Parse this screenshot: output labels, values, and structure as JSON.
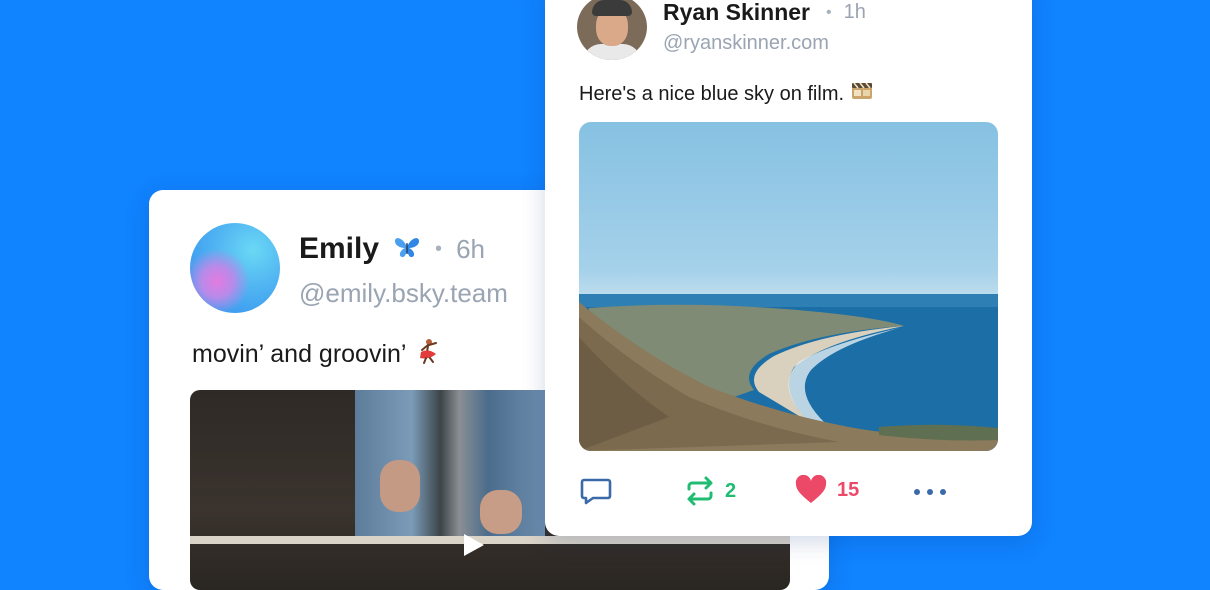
{
  "posts": {
    "emily": {
      "display_name": "Emily",
      "name_emoji": "butterfly-icon",
      "time": "6h",
      "handle": "@emily.bsky.team",
      "text": "movin’ and groovin’",
      "text_emoji": "dancer-icon",
      "media": "video"
    },
    "ryan": {
      "display_name": "Ryan Skinner",
      "time": "1h",
      "handle": "@ryanskinner.com",
      "text": "Here's a nice blue sky on film.",
      "text_emoji": "film-icon",
      "media": "image",
      "actions": {
        "reply_icon": "reply-icon",
        "repost_icon": "repost-icon",
        "repost_count": "2",
        "like_icon": "heart-icon",
        "like_count": "15",
        "more_icon": "more-icon"
      }
    }
  },
  "separator": "•",
  "colors": {
    "background": "#1083fe",
    "card": "#ffffff",
    "muted_text": "#9aa4b2",
    "repost_green": "#20bc72",
    "like_pink": "#ec4868",
    "action_blue": "#3a6aa8"
  }
}
